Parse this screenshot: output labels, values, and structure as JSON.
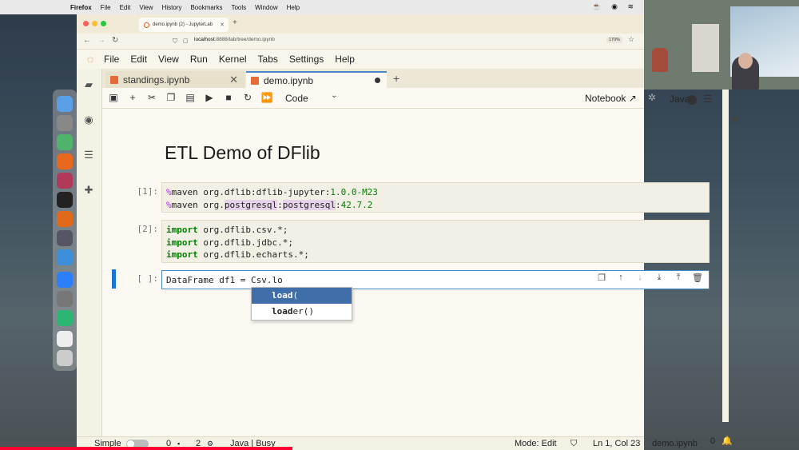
{
  "mac_menubar": {
    "app": "Firefox",
    "items": [
      "File",
      "Edit",
      "View",
      "History",
      "Bookmarks",
      "Tools",
      "Window",
      "Help"
    ]
  },
  "browser": {
    "tab_title": "demo.ipynb (2) - JupyterLab",
    "url_host": "localhost",
    "url_rest": ":8888/lab/tree/demo.ipynb",
    "zoom": "170%"
  },
  "jupyter": {
    "menu": [
      "File",
      "Edit",
      "View",
      "Run",
      "Kernel",
      "Tabs",
      "Settings",
      "Help"
    ],
    "tabs": [
      {
        "label": "standings.ipynb"
      },
      {
        "label": "demo.ipynb"
      }
    ],
    "toolbar": {
      "cell_type": "Code",
      "notebook_label": "Notebook",
      "kernel": "Java"
    },
    "heading": "ETL Demo of DFlib",
    "cells": [
      {
        "prompt": "[1]:"
      },
      {
        "prompt": "[2]:"
      },
      {
        "prompt": "[ ]:"
      }
    ],
    "cell1": {
      "l1_magic": "%",
      "l1_word": "maven",
      "l1_pkg": " org.dflib:dflib-jupyter:",
      "l1_ver": "1.0.0-M23",
      "l2_magic": "%",
      "l2_word": "maven",
      "l2_pkg": " org.",
      "l2_hl1": "postgresql",
      "l2_colon": ":",
      "l2_hl2": "postgresql",
      "l2_colon2": ":",
      "l2_ver": "42.7.2"
    },
    "cell2": {
      "kw": "import",
      "lines": [
        " org.dflib.csv.*;",
        " org.dflib.jdbc.*;",
        " org.dflib.echarts.*;"
      ]
    },
    "cell3": {
      "code": "DataFrame df1 = Csv.lo"
    },
    "completer": [
      {
        "match": "load",
        "rest": "("
      },
      {
        "match": "load",
        "rest": "er()"
      }
    ],
    "status": {
      "mode_simple": "Simple",
      "terminals": "0",
      "kernels": "2",
      "kernel_status": "Java | Busy",
      "mode": "Mode: Edit",
      "position": "Ln 1, Col 23",
      "file": "demo.ipynb",
      "notifications": "0"
    }
  }
}
